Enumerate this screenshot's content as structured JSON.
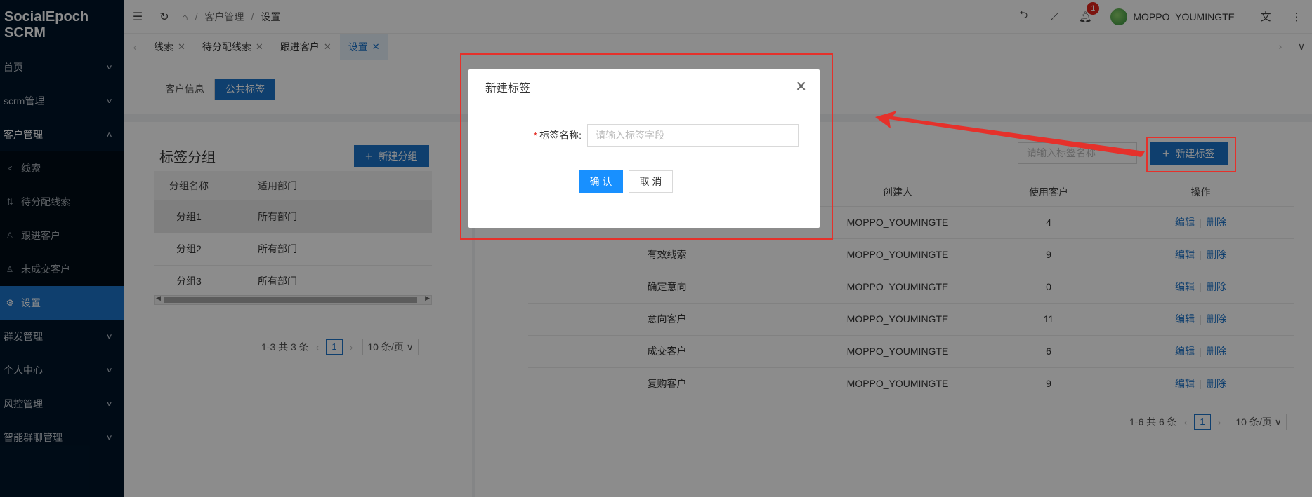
{
  "app": {
    "logo": "SocialEpoch SCRM"
  },
  "sidebar": {
    "items": [
      {
        "label": "首页"
      },
      {
        "label": "scrm管理"
      },
      {
        "label": "客户管理"
      },
      {
        "label": "群发管理"
      },
      {
        "label": "个人中心"
      },
      {
        "label": "风控管理"
      },
      {
        "label": "智能群聊管理"
      }
    ],
    "submenu": [
      {
        "label": "线索",
        "icon": "share-icon"
      },
      {
        "label": "待分配线索",
        "icon": "assign-icon"
      },
      {
        "label": "跟进客户",
        "icon": "user-icon"
      },
      {
        "label": "未成交客户",
        "icon": "user-icon"
      },
      {
        "label": "设置",
        "icon": "gear-icon"
      }
    ]
  },
  "header": {
    "breadcrumb": [
      "客户管理",
      "设置"
    ],
    "notification_count": "1",
    "username": "MOPPO_YOUMINGTE"
  },
  "tabs": [
    {
      "label": "线索"
    },
    {
      "label": "待分配线索"
    },
    {
      "label": "跟进客户"
    },
    {
      "label": "设置"
    }
  ],
  "segment": {
    "options": [
      "客户信息",
      "公共标签"
    ],
    "selected": "公共标签"
  },
  "group_panel": {
    "title": "标签分组",
    "new_button": "新建分组",
    "columns": [
      "分组名称",
      "适用部门"
    ],
    "rows": [
      [
        "分组1",
        "所有部门"
      ],
      [
        "分组2",
        "所有部门"
      ],
      [
        "分组3",
        "所有部门"
      ]
    ],
    "pager": {
      "summary": "1-3 共 3 条",
      "page": "1",
      "size": "10 条/页"
    }
  },
  "tag_panel": {
    "search_placeholder": "请输入标签名称",
    "new_button": "新建标签",
    "columns": [
      "",
      "创建人",
      "使用客户",
      "操作"
    ],
    "rows": [
      [
        "",
        "MOPPO_YOUMINGTE",
        "4"
      ],
      [
        "有效线索",
        "MOPPO_YOUMINGTE",
        "9"
      ],
      [
        "确定意向",
        "MOPPO_YOUMINGTE",
        "0"
      ],
      [
        "意向客户",
        "MOPPO_YOUMINGTE",
        "11"
      ],
      [
        "成交客户",
        "MOPPO_YOUMINGTE",
        "6"
      ],
      [
        "复购客户",
        "MOPPO_YOUMINGTE",
        "9"
      ]
    ],
    "actions": {
      "edit": "编辑",
      "delete": "删除"
    },
    "pager": {
      "summary": "1-6 共 6 条",
      "page": "1",
      "size": "10 条/页"
    }
  },
  "modal": {
    "title": "新建标签",
    "field_label": "标签名称:",
    "field_placeholder": "请输入标签字段",
    "confirm": "确 认",
    "cancel": "取 消"
  },
  "colors": {
    "sidebar": "#001529",
    "primary": "#1d73c9",
    "annotation": "#e5312b"
  }
}
